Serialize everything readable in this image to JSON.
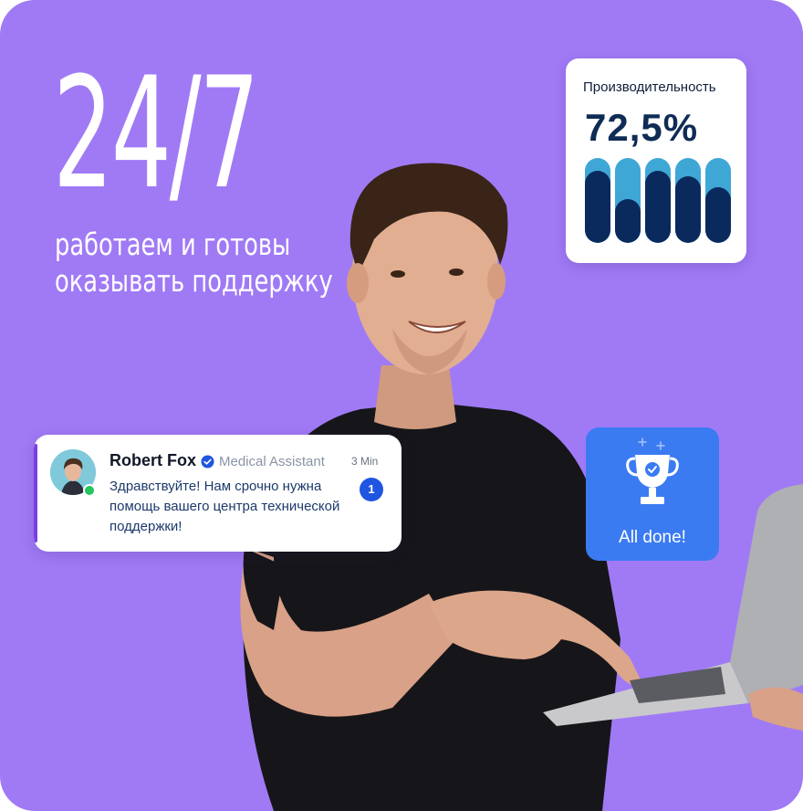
{
  "headline": {
    "big": "24/7",
    "line1": "работаем и готовы",
    "line2": "оказывать поддержку"
  },
  "productivity": {
    "title": "Производительность",
    "value": "72,5%",
    "bars": [
      0.85,
      0.52,
      0.85,
      0.78,
      0.66
    ]
  },
  "chat": {
    "name": "Robert Fox",
    "role": "Medical Assistant",
    "time": "3 Min",
    "message": "Здравствуйте! Нам срочно нужна помощь вашего центра технической поддержки!",
    "unread": "1",
    "verified_icon": "verified-check-icon",
    "avatar": "avatar"
  },
  "done_card": {
    "label": "All done!",
    "icon": "trophy-icon"
  },
  "colors": {
    "background": "#a07af5",
    "bar_light": "#3fa7d6",
    "bar_dark": "#0a2a5e",
    "done_bg": "#3b7bf2",
    "badge": "#1f55e0",
    "accent": "#7b3fe4"
  }
}
